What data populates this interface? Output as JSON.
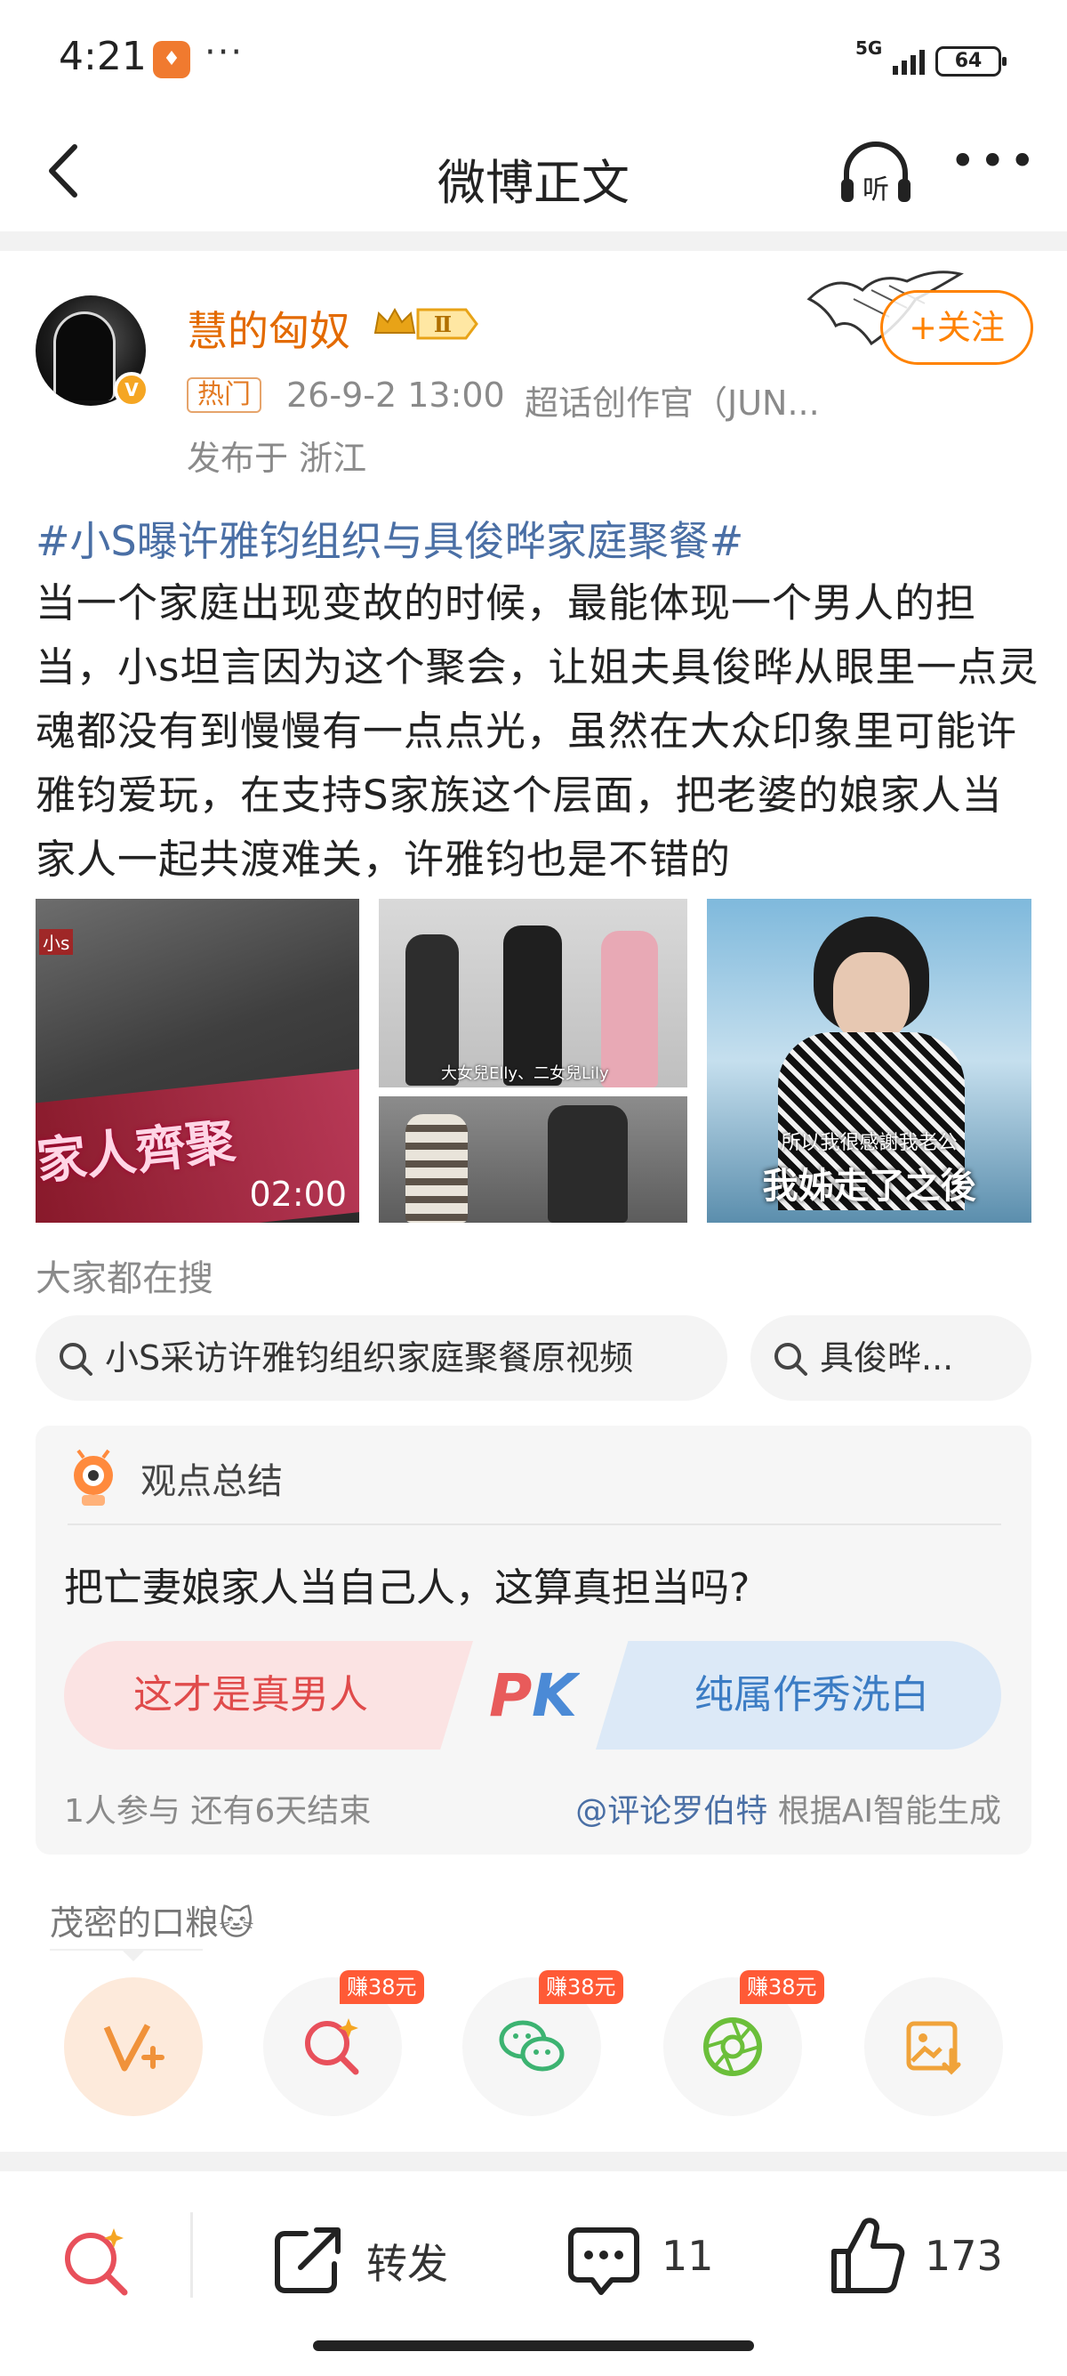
{
  "status_bar": {
    "time": "4:21",
    "more": "···",
    "network": "5G",
    "battery": "64"
  },
  "nav": {
    "title": "微博正文",
    "listen_label": "听"
  },
  "author": {
    "name": "慧的匈奴",
    "vip_level": "Ⅱ",
    "hot_tag": "热门",
    "time": "26-9-2 13:00",
    "source": "超话创作官（JUN...",
    "location": "发布于 浙江",
    "follow_label": "+关注"
  },
  "post": {
    "topic": "#小S曝许雅钧组织与具俊晔家庭聚餐#",
    "body": "当一个家庭出现变故的时候，最能体现一个男人的担当，小s坦言因为这个聚会，让姐夫具俊晔从眼里一点灵魂都没有到慢慢有一点点光，虽然在大众印象里可能许雅钧爱玩，在支持S家族这个层面，把老婆的娘家人当家人一起共渡难关，许雅钧也是不错的"
  },
  "images": {
    "video_duration": "02:00",
    "video_caption": "家人齊聚",
    "img2_caption": "大女兒Elly、二女兒Lily",
    "img4_caption_small": "所以我很感謝我老公",
    "img4_caption_big": "我姊走了之後"
  },
  "searches": {
    "title": "大家都在搜",
    "items": [
      "小S采访许雅钧组织家庭聚餐原视频",
      "具俊晔..."
    ]
  },
  "poll": {
    "header": "观点总结",
    "question": "把亡妻娘家人当自己人，这算真担当吗?",
    "option_left": "这才是真男人",
    "pk": "PK",
    "option_right": "纯属作秀洗白",
    "stats": "1人参与  还有6天结束",
    "credit_mention": "@评论罗伯特",
    "credit_suffix": " 根据AI智能生成"
  },
  "tip": {
    "text": "茂密的口粮🐱"
  },
  "share": {
    "earn_label": "赚38元"
  },
  "bottom_bar": {
    "repost_label": "转发",
    "comment_count": "11",
    "like_count": "173"
  },
  "colors": {
    "accent_orange": "#ff8200",
    "link_blue": "#4a6fa5",
    "poll_red": "#e04b4b",
    "poll_blue": "#3b7cc4"
  }
}
